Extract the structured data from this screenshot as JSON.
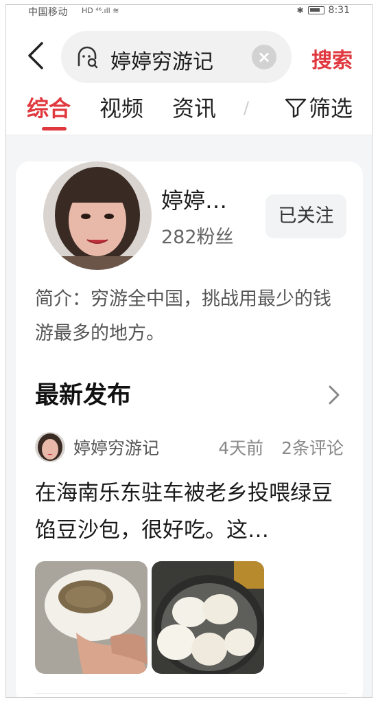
{
  "status_bar": {
    "carrier": "中国移动",
    "signal": "HD ⁴⁶.ıll ≋",
    "time": "8:31"
  },
  "search": {
    "query": "婷婷穷游记",
    "clear_icon": "close-icon",
    "search_button": "搜索"
  },
  "tabs": [
    {
      "label": "综合",
      "active": true
    },
    {
      "label": "视频",
      "active": false
    },
    {
      "label": "资讯",
      "active": false
    },
    {
      "label": "/",
      "active": false
    }
  ],
  "filter_label": "筛选",
  "user_card": {
    "name": "婷婷…",
    "fans": "282粉丝",
    "follow_label": "已关注",
    "bio": "简介：穷游全中国，挑战用最少的钱游最多的地方。"
  },
  "latest": {
    "title": "最新发布",
    "post": {
      "author": "婷婷穷游记",
      "time": "4天前",
      "comments": "2条评论",
      "title": "在海南乐东驻车被老乡投喂绿豆馅豆沙包，很好吃。这…"
    }
  },
  "colors": {
    "accent": "#e0383e",
    "background": "#f4f5f7"
  }
}
